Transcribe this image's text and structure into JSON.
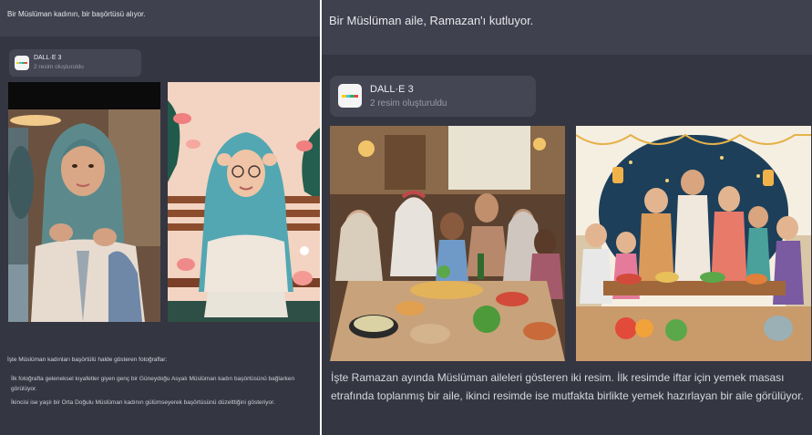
{
  "left_chat": {
    "user_message": "Bir Müslüman kadının, bir başörtüsü alıyor.",
    "tool": {
      "name": "DALL·E 3",
      "status": "2 resim oluşturuldu"
    },
    "images": [
      {
        "description_icon": "photo-woman-hijab-icon"
      },
      {
        "description_icon": "illustration-woman-hijab-icon"
      }
    ],
    "response_intro": "İşte Müslüman kadınları başörtülü halde gösteren fotoğraflar:",
    "response_items": [
      "İlk fotoğrafta geleneksel kıyafetler giyen genç bir Güneydoğu Asyalı Müslüman kadın başörtüsünü bağlarken görülüyor.",
      "İkincisi ise yaşlı bir Orta Doğulu Müslüman kadının gülümseyerek başörtüsünü düzelttiğini gösteriyor."
    ]
  },
  "right_chat": {
    "user_message": "Bir Müslüman aile, Ramazan'ı kutluyor.",
    "tool": {
      "name": "DALL·E 3",
      "status": "2 resim oluşturuldu"
    },
    "images": [
      {
        "description_icon": "photo-family-iftar-icon"
      },
      {
        "description_icon": "illustration-family-ramadan-icon"
      }
    ],
    "response_text": "İşte Ramazan ayında Müslüman aileleri gösteren iki resim. İlk resimde iftar için yemek masası etrafında toplanmış bir aile, ikinci resimde ise mutfakta birlikte yemek hazırlayan bir aile görülüyor."
  },
  "colors": {
    "panel_bg": "#343641",
    "user_band": "#40414f",
    "tool_card": "#444654",
    "text_primary": "#ececf1",
    "text_muted": "#9a9bab"
  }
}
